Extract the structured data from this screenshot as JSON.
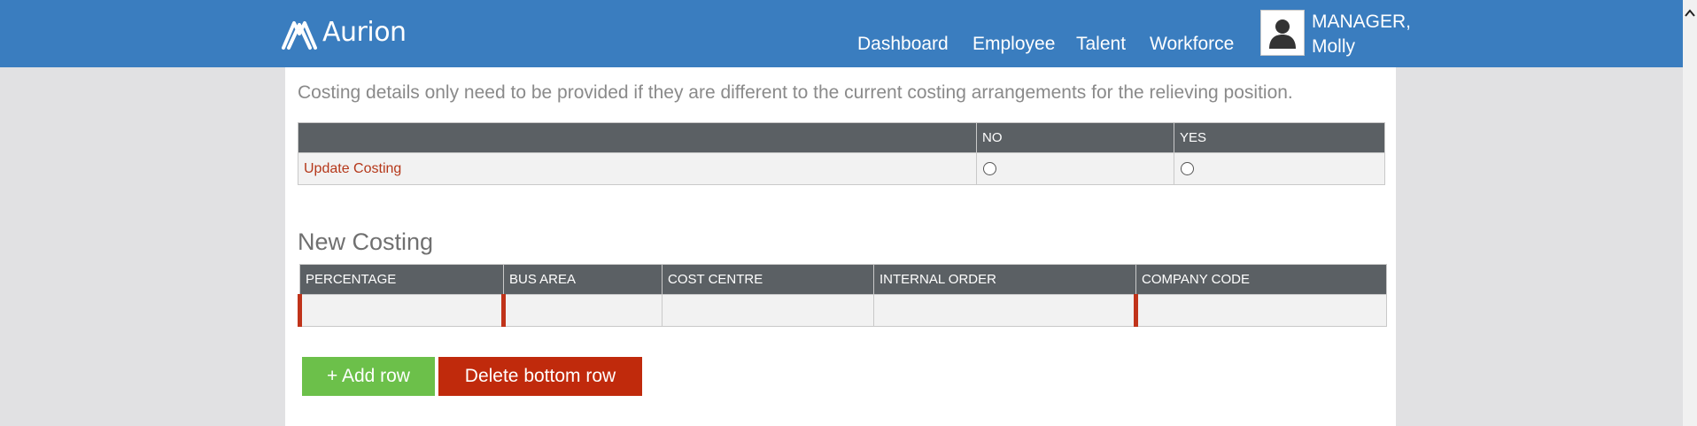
{
  "header": {
    "logo_text": "Aurion",
    "nav": [
      {
        "label": "Dashboard"
      },
      {
        "label": "Employee"
      },
      {
        "label": "Talent"
      },
      {
        "label": "Workforce"
      }
    ],
    "user": {
      "line1": "MANAGER,",
      "line2": "Molly"
    }
  },
  "costing": {
    "note": "Costing details only need to be provided if they are different to the current costing arrangements for the relieving position.",
    "columns": {
      "no": "NO",
      "yes": "YES"
    },
    "row_label": "Update Costing"
  },
  "new_costing": {
    "title": "New Costing",
    "columns": [
      "PERCENTAGE",
      "BUS AREA",
      "COST CENTRE",
      "INTERNAL ORDER",
      "COMPANY CODE"
    ]
  },
  "buttons": {
    "add": "+ Add row",
    "delete": "Delete bottom row"
  },
  "colors": {
    "header": "#3a7dbf",
    "table_header": "#5b6064",
    "add": "#6cc04a",
    "delete": "#c02a0c",
    "link": "#b5381a"
  },
  "icons": {
    "avatar": "person-icon",
    "scroll": "chevron-up-icon",
    "logo": "aurion-logo-icon"
  }
}
